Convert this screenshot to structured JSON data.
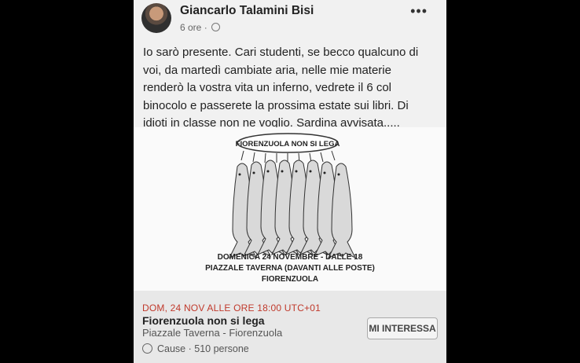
{
  "post": {
    "author": "Giancarlo Talamini Bisi",
    "time": "6 ore",
    "dot": "·",
    "more_icon": "ellipsis-icon",
    "text": "Io sarò presente. Cari studenti, se becco qualcuno di\nvoi, da martedì cambiate aria, nelle mie materie\nrenderò la vostra vita un inferno, vedrete il 6 col\nbinocolo e passerete la prossima estate sui libri. Di\nidioti in classe non ne voglio. Sardina avvisata....."
  },
  "poster": {
    "bubble": "FIORENZUOLA NON SI LEGA",
    "line1": "DOMENICA 24 NOVEMBRE - DALLE 18",
    "line2": "PIAZZALE TAVERNA (DAVANTI ALLE POSTE)",
    "line3": "FIORENZUOLA"
  },
  "event": {
    "date": "DOM, 24 NOV ALLE ORE 18:00 UTC+01",
    "title": "Fiorenzuola non si lega",
    "place": "Piazzale Taverna - Fiorenzuola",
    "cause": "Cause · 510 persone",
    "button": "MI INTERESSA"
  }
}
